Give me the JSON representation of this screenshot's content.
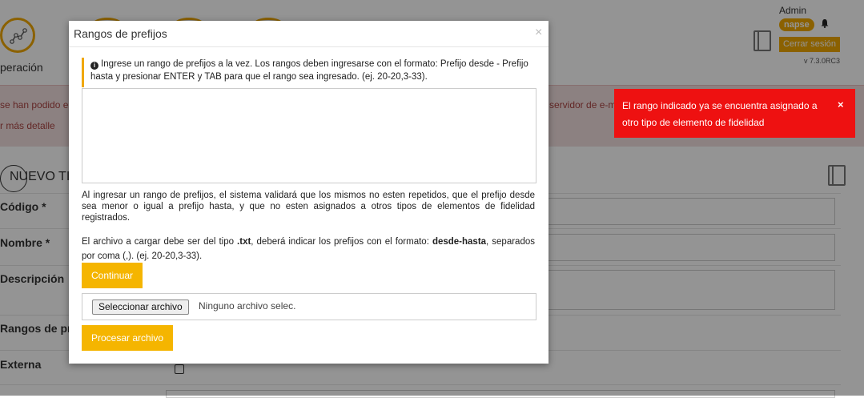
{
  "header": {
    "module_label": "peración",
    "user_name": "Admin",
    "company_badge": "napse",
    "logout_label": "Cerrar sesión",
    "version": "v 7.3.0RC3"
  },
  "alert": {
    "line1": "se han podido e",
    "line1_right": "l servidor de e-m",
    "line2": "r más detalle"
  },
  "form": {
    "section_title": "NUEVO TIPO",
    "fields": [
      {
        "label": "Código *"
      },
      {
        "label": "Nombre *"
      },
      {
        "label": "Descripción"
      },
      {
        "label": "Rangos de pre"
      },
      {
        "label": "Externa"
      }
    ]
  },
  "modal": {
    "title": "Rangos de prefijos",
    "close_glyph": "×",
    "info_text": "Ingrese un rango de prefijos a la vez. Los rangos deben ingresarse con el formato: Prefijo desde - Prefijo hasta y presionar ENTER y TAB para que el rango sea ingresado. (ej. 20-20,3-33).",
    "info_icon_glyph": "i",
    "textarea_value": "",
    "validation_text": "Al ingresar un rango de prefijos, el sistema validará que los mismos no esten repetidos, que el prefijo desde sea menor o igual a prefijo hasta, y que no esten asignados a otros tipos de elementos de fidelidad registrados.",
    "file_text_prefix": "El archivo a cargar debe ser del tipo ",
    "file_text_ext": ".txt",
    "file_text_mid": ", deberá indicar los prefijos con el formato: ",
    "file_text_format": "desde-hasta",
    "file_text_suffix": ", separados por coma (,). (ej. 20-20,3-33).",
    "continue_label": "Continuar",
    "file_button_label": "Seleccionar archivo",
    "file_status": "Ninguno archivo selec.",
    "process_label": "Procesar archivo"
  },
  "toast": {
    "message": "El rango indicado ya se encuentra asignado a otro tipo de elemento de fidelidad",
    "close_glyph": "×"
  },
  "colors": {
    "accent": "#f5b500",
    "error": "#ee1111",
    "alert_bg": "#f2dede"
  }
}
